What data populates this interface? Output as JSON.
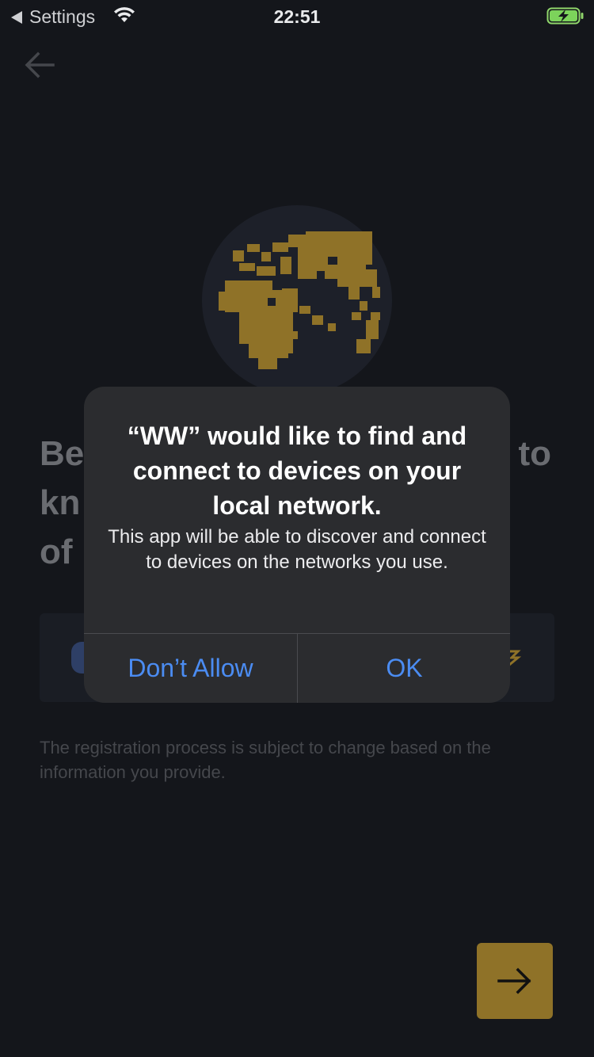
{
  "status_bar": {
    "back_label": "Settings",
    "time": "22:51",
    "back_icon": "back-triangle-icon",
    "wifi_icon": "wifi-icon",
    "battery_icon": "battery-charging-icon"
  },
  "header": {
    "back_icon": "arrow-left-icon"
  },
  "hero": {
    "icon": "globe-icon",
    "globe_fill": "#8f7228"
  },
  "headline": {
    "line1": "Be",
    "line1_tail": "to",
    "line2": "kn",
    "line3": "of"
  },
  "footer": {
    "disclaimer": "The registration process is subject to change based on the information you provide."
  },
  "next_button": {
    "icon": "arrow-right-icon",
    "color": "#8f7228"
  },
  "alert": {
    "title": "“WW” would like to find and connect to devices on your local network.",
    "message": "This app will be able to discover and connect to devices on the networks you use.",
    "deny_label": "Don’t Allow",
    "allow_label": "OK",
    "button_color": "#4b8cf2"
  }
}
